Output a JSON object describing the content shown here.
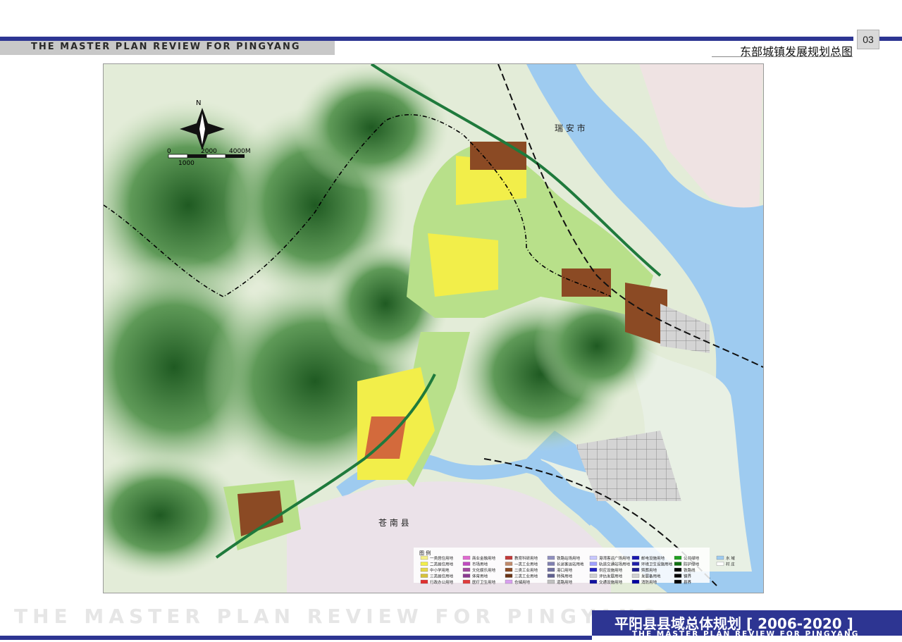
{
  "header": {
    "title_en": "THE MASTER PLAN REVIEW FOR PINGYANG",
    "map_title": "东部城镇发展规划总图",
    "page_number": "03"
  },
  "footer": {
    "watermark": "THE MASTER PLAN REVIEW FOR PINGYANG",
    "title_cn": "平阳县县域总体规划 [ 2006-2020 ]",
    "title_en": "THE MASTER PLAN REVIEW FOR PINGYANG"
  },
  "map": {
    "north_label": "N",
    "scale": {
      "zero": "0",
      "mid": "2000",
      "end": "4000M",
      "sub": "1000"
    },
    "place_labels": {
      "ruian": "瑞 安 市",
      "cangnan": "苍 南 县"
    },
    "colors": {
      "water": "#9ecbf0",
      "mountain_dark": "#2f6b2f",
      "mountain_light": "#c6ddb9",
      "land": "#e3ecd8",
      "urban_green": "#b8e08a",
      "residential": "#f2ee4a",
      "industrial": "#8b4a24",
      "reserve": "#c9c9c9",
      "boundary": "#000000"
    }
  },
  "legend": {
    "title": "图 例",
    "items": [
      "一类居住用地",
      "二类居住用地",
      "中小学用地",
      "三类居住用地",
      "行政办公用地",
      "商业金融用地",
      "市场用地",
      "文化娱乐用地",
      "体育用地",
      "医疗卫生用地",
      "教育科研用地",
      "一类工业用地",
      "二类工业用地",
      "三类工业用地",
      "仓储用地",
      "铁路站场用地",
      "长途客运站用地",
      "港口用地",
      "特殊用地",
      "道路用地",
      "港湾客运广场用地",
      "轨道交通站场用地",
      "供应设施用地",
      "评估发展用地",
      "交通设施用地",
      "邮电设施用地",
      "环境卫生设施用地",
      "殡葬用地",
      "发展备用地",
      "消防用地",
      "公共绿地",
      "防护绿地",
      "铁路线",
      "镇界",
      "县界",
      "水 域",
      "村 庄"
    ]
  }
}
